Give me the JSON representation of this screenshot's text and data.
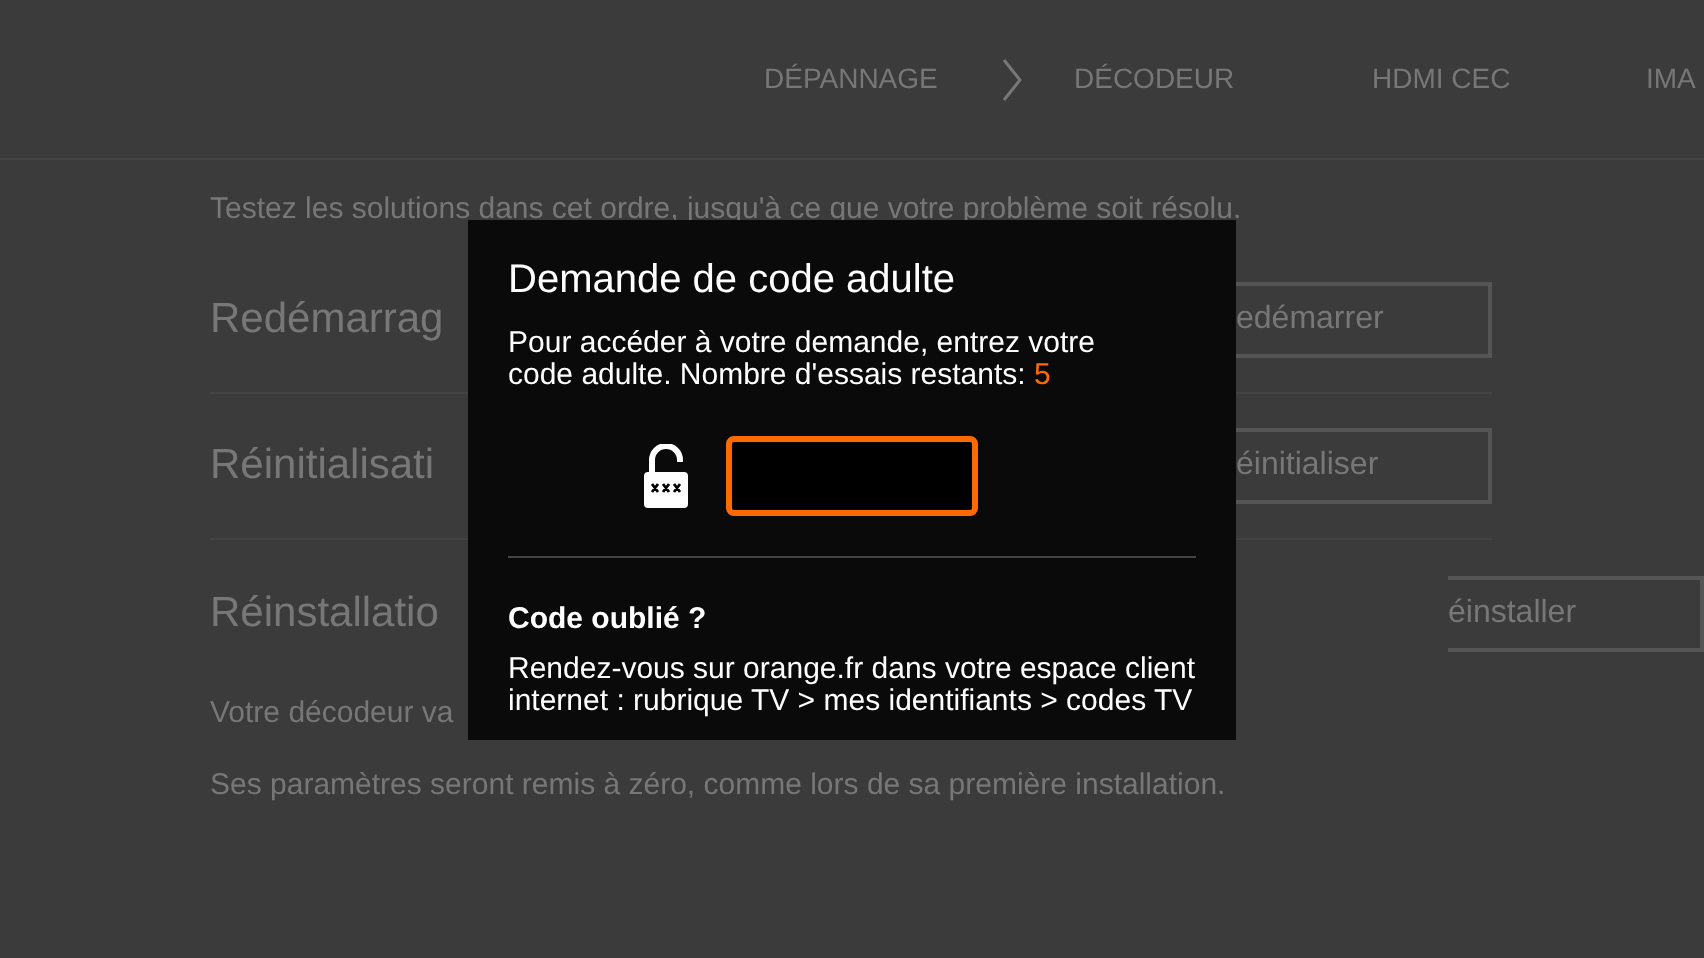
{
  "nav": [
    {
      "label": "DÉPANNAGE",
      "kind": "current"
    },
    {
      "label": "DÉCODEUR",
      "kind": "link"
    },
    {
      "label": "HDMI CEC",
      "kind": "link"
    },
    {
      "label": "IMA",
      "kind": "link"
    }
  ],
  "intro": "Testez les solutions dans cet ordre, jusqu'à ce que votre problème soit résolu.",
  "solutions": [
    {
      "title": "Redémarrag",
      "button": "edémarrer"
    },
    {
      "title": "Réinitialisati",
      "button": "éinitialiser"
    },
    {
      "title": "Réinstallatio",
      "button": "éinstaller"
    }
  ],
  "notes": [
    "Votre décodeur va",
    "Ses paramètres seront remis à zéro, comme lors de sa première installation."
  ],
  "dialog": {
    "title": "Demande de code adulte",
    "message": "Pour accéder à votre demande, entrez votre code adulte. Nombre d'essais restants:",
    "attempts_left": "5",
    "forgot_title": "Code oublié ?",
    "forgot_text": "Rendez-vous sur orange.fr dans votre espace client internet : rubrique TV > mes identifiants > codes TV"
  }
}
